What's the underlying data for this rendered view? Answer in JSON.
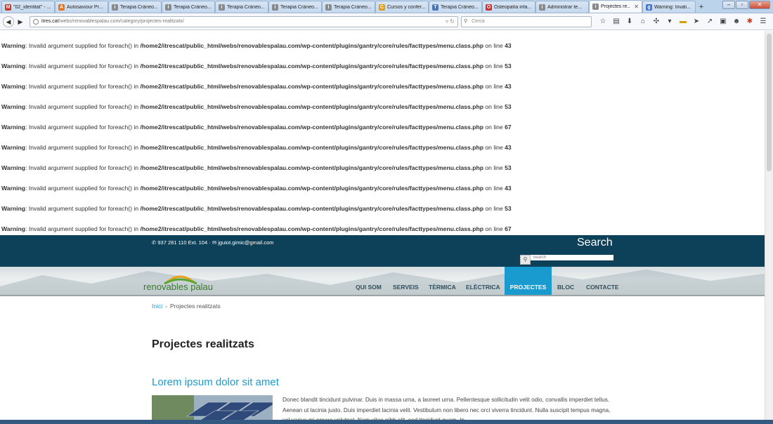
{
  "browser": {
    "tabs": [
      {
        "title": "\"02_identitat\" - ...",
        "icon": "gmail-icon",
        "color": "#c4372a",
        "glyph": "M"
      },
      {
        "title": "Autosaviour Pr...",
        "icon": "autosaviour-icon",
        "color": "#e6721c",
        "glyph": "A"
      },
      {
        "title": "Terapia Cráneo...",
        "icon": "page-icon",
        "color": "#8a8a8a",
        "glyph": "i"
      },
      {
        "title": "Terapia Cráneo...",
        "icon": "page-icon",
        "color": "#8a8a8a",
        "glyph": "i"
      },
      {
        "title": "Terapia Cráneo...",
        "icon": "page-icon",
        "color": "#8a8a8a",
        "glyph": "i"
      },
      {
        "title": "Terapia Cráneo...",
        "icon": "page-icon",
        "color": "#8a8a8a",
        "glyph": "i"
      },
      {
        "title": "Terapia Cráneo...",
        "icon": "page-icon",
        "color": "#8a8a8a",
        "glyph": "i"
      },
      {
        "title": "Cursos y confer...",
        "icon": "cursos-icon",
        "color": "#e39b14",
        "glyph": "C"
      },
      {
        "title": "Terapia Cráneo...",
        "icon": "doc-icon",
        "color": "#4a77b4",
        "glyph": "T"
      },
      {
        "title": "Osteopatía infa...",
        "icon": "osteo-icon",
        "color": "#c93030",
        "glyph": "O"
      },
      {
        "title": "Administrar te...",
        "icon": "page-icon",
        "color": "#8a8a8a",
        "glyph": "i"
      },
      {
        "title": "Projectes re...",
        "icon": "page-icon",
        "color": "#8a8a8a",
        "glyph": "i",
        "active": true
      },
      {
        "title": "Warning: Invali...",
        "icon": "google-icon",
        "color": "#3d76d8",
        "glyph": "g"
      }
    ],
    "url_host": "itres.cat",
    "url_path": "/webs/renovablespalau.com/category/projectes-realitzats/",
    "search_placeholder": "Cerca"
  },
  "warnings": [
    {
      "label": "Warning",
      "msg": ": Invalid argument supplied for foreach() in ",
      "path": "/home2/itrescat/public_html/webs/renovablespalau.com/wp-content/plugins/gantry/core/rules/facttypes/menu.class.php",
      "online": " on line ",
      "line": "43"
    },
    {
      "label": "Warning",
      "msg": ": Invalid argument supplied for foreach() in ",
      "path": "/home2/itrescat/public_html/webs/renovablespalau.com/wp-content/plugins/gantry/core/rules/facttypes/menu.class.php",
      "online": " on line ",
      "line": "53"
    },
    {
      "label": "Warning",
      "msg": ": Invalid argument supplied for foreach() in ",
      "path": "/home2/itrescat/public_html/webs/renovablespalau.com/wp-content/plugins/gantry/core/rules/facttypes/menu.class.php",
      "online": " on line ",
      "line": "43"
    },
    {
      "label": "Warning",
      "msg": ": Invalid argument supplied for foreach() in ",
      "path": "/home2/itrescat/public_html/webs/renovablespalau.com/wp-content/plugins/gantry/core/rules/facttypes/menu.class.php",
      "online": " on line ",
      "line": "53"
    },
    {
      "label": "Warning",
      "msg": ": Invalid argument supplied for foreach() in ",
      "path": "/home2/itrescat/public_html/webs/renovablespalau.com/wp-content/plugins/gantry/core/rules/facttypes/menu.class.php",
      "online": " on line ",
      "line": "67"
    },
    {
      "label": "Warning",
      "msg": ": Invalid argument supplied for foreach() in ",
      "path": "/home2/itrescat/public_html/webs/renovablespalau.com/wp-content/plugins/gantry/core/rules/facttypes/menu.class.php",
      "online": " on line ",
      "line": "43"
    },
    {
      "label": "Warning",
      "msg": ": Invalid argument supplied for foreach() in ",
      "path": "/home2/itrescat/public_html/webs/renovablespalau.com/wp-content/plugins/gantry/core/rules/facttypes/menu.class.php",
      "online": " on line ",
      "line": "53"
    },
    {
      "label": "Warning",
      "msg": ": Invalid argument supplied for foreach() in ",
      "path": "/home2/itrescat/public_html/webs/renovablespalau.com/wp-content/plugins/gantry/core/rules/facttypes/menu.class.php",
      "online": " on line ",
      "line": "43"
    },
    {
      "label": "Warning",
      "msg": ": Invalid argument supplied for foreach() in ",
      "path": "/home2/itrescat/public_html/webs/renovablespalau.com/wp-content/plugins/gantry/core/rules/facttypes/menu.class.php",
      "online": " on line ",
      "line": "53"
    },
    {
      "label": "Warning",
      "msg": ": Invalid argument supplied for foreach() in ",
      "path": "/home2/itrescat/public_html/webs/renovablespalau.com/wp-content/plugins/gantry/core/rules/facttypes/menu.class.php",
      "online": " on line ",
      "line": "67"
    }
  ],
  "site": {
    "contact_phone": "937 281 110 Ext. 104",
    "contact_sep": " · ",
    "contact_email": "jguiot.gimic@gmail.com",
    "search_title": "Search",
    "search_input_placeholder": "Search",
    "logo_text": "renovables palau",
    "menu": [
      {
        "label": "QUI SOM"
      },
      {
        "label": "SERVEIS"
      },
      {
        "label": "TÈRMICA"
      },
      {
        "label": "ELÈCTRICA"
      },
      {
        "label": "PROJECTES",
        "active": true
      },
      {
        "label": "BLOC"
      },
      {
        "label": "CONTACTE"
      }
    ],
    "breadcrumb_home": "Inici",
    "breadcrumb_sep": "›",
    "breadcrumb_current": "Projectes realitzats",
    "page_title": "Projectes realitzats",
    "post_title": "Lorem ipsum dolor sit amet",
    "post_excerpt": "Donec blandit tincidunt pulvinar. Duis in massa urna, a laoreet urna. Pellentesque sollicitudin velit odio, convallis imperdiet tellus. Aenean ut lacinia justo. Duis imperdiet lacinia velit. Vestibulum non libero nec orci viverra tincidunt. Nulla suscipit tempus magna, vel varius mi ornare volutpat. Nam vitae nibh elit, sed tincidunt quam. In"
  },
  "colors": {
    "header": "#0d4159",
    "accent": "#1a9bd0"
  }
}
